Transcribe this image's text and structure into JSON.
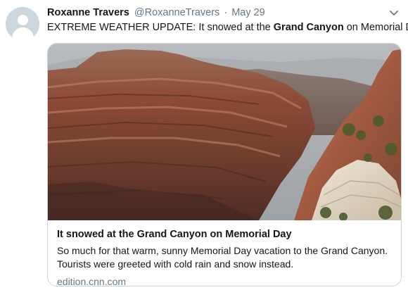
{
  "tweet": {
    "display_name": "Roxanne Travers",
    "handle": "@RoxanneTravers",
    "separator": "·",
    "date": "May 29",
    "text_before": "EXTREME WEATHER UPDATE: It snowed at the ",
    "text_bold": "Grand Canyon",
    "text_after": " on Memorial Day",
    "avatar": "default-avatar-icon",
    "menu_icon": "chevron-down-icon"
  },
  "card": {
    "image": "grand-canyon-photo",
    "title": "It snowed at the Grand Canyon on Memorial Day",
    "description": "So much for that warm, sunny Memorial Day vacation to the Grand Canyon. Tourists were greeted with cold rain and snow instead.",
    "domain": "edition.cnn.com"
  },
  "colors": {
    "text": "#14171a",
    "secondary": "#657786",
    "border": "#ccd6dd"
  }
}
